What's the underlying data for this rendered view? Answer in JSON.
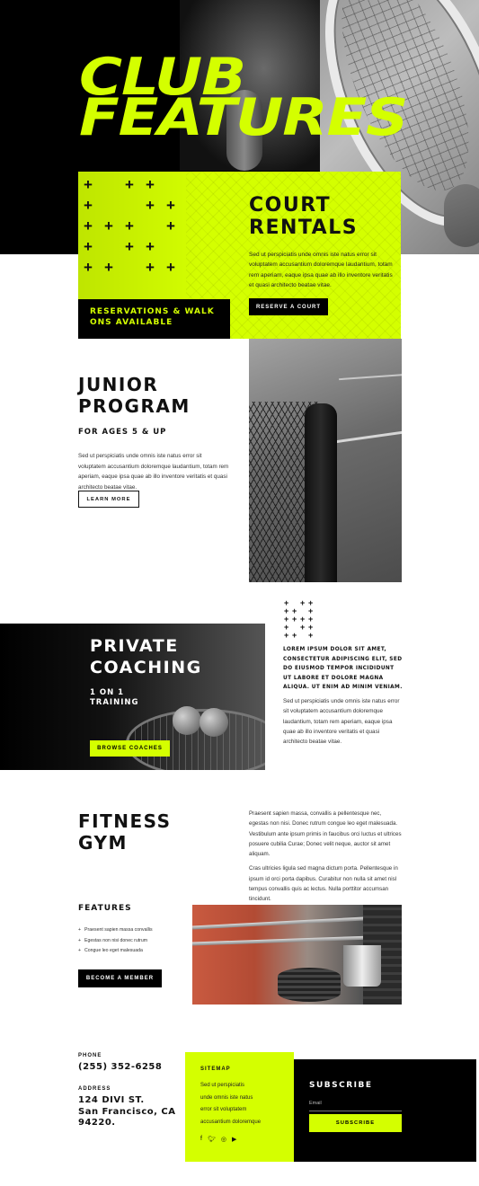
{
  "hero": {
    "title_line1": "CLUB",
    "title_line2": "FEATURES"
  },
  "court": {
    "title_line1": "COURT",
    "title_line2": "RENTALS",
    "text": "Sed ut perspiciatis unde omnis iste natus error sit voluptatem accusantium doloremque laudantium, totam rem aperiam, eaque ipsa quae ab illo inventore veritatis et quasi architecto beatae vitae.",
    "button": "RESERVE A COURT",
    "badge_line1": "RESERVATIONS & WALK",
    "badge_line2": "ONS AVAILABLE"
  },
  "junior": {
    "title_line1": "JUNIOR",
    "title_line2": "PROGRAM",
    "subtitle": "FOR AGES 5 & UP",
    "text": "Sed ut perspiciatis unde omnis iste natus error sit voluptatem accusantium doloremque laudantium, totam rem aperiam, eaque ipsa quae ab illo inventore veritatis et quasi architecto beatae vitae.",
    "button": "LEARN MORE"
  },
  "coaching": {
    "title_line1": "PRIVATE",
    "title_line2": "COACHING",
    "sub_line1": "1 ON 1",
    "sub_line2": "TRAINING",
    "button": "BROWSE COACHES",
    "bold_text": "LOREM IPSUM DOLOR SIT AMET, CONSECTETUR ADIPISCING ELIT, SED DO EIUSMOD TEMPOR INCIDIDUNT UT LABORE ET DOLORE MAGNA ALIQUA. UT ENIM AD MINIM VENIAM.",
    "text": "Sed ut perspiciatis unde omnis iste natus error sit voluptatem accusantium doloremque laudantium, totam rem aperiam, eaque ipsa quae ab illo inventore veritatis et quasi architecto beatae vitae."
  },
  "fitness": {
    "title_line1": "FITNESS",
    "title_line2": "GYM",
    "para1": "Praesent sapien massa, convallis a pellentesque nec, egestas non nisi. Donec rutrum congue leo eget malesuada. Vestibulum ante ipsum primis in faucibus orci luctus et ultrices posuere cubilia Curae; Donec velit neque, auctor sit amet aliquam.",
    "para2": "Cras ultricies ligula sed magna dictum porta. Pellentesque in ipsum id orci porta dapibus. Curabitur non nulla sit amet nisl tempus convallis quis ac lectus. Nulla porttitor accumsan tincidunt.",
    "features_title": "FEATURES",
    "features": [
      "Praesent sapien massa convallis",
      "Egestas non nisi donec rutrum",
      "Congue leo eget malesuada"
    ],
    "button": "BECOME A MEMBER"
  },
  "footer": {
    "phone_label": "PHONE",
    "phone": "(255) 352-6258",
    "address_label": "ADDRESS",
    "address_line1": "124 DIVI ST.",
    "address_line2": "San Francisco, CA",
    "address_line3": "94220.",
    "sitemap_title": "SITEMAP",
    "sitemap_links": [
      "Sed ut perspiciatis",
      "unde omnis iste natus",
      "error sit voluptatem",
      "accusantium doloremque"
    ],
    "socials": [
      "facebook-icon",
      "twitter-icon",
      "instagram-icon",
      "youtube-icon"
    ],
    "subscribe_title": "SUBSCRIBE",
    "email_placeholder": "Email",
    "subscribe_button": "SUBSCRIBE"
  },
  "colors": {
    "accent": "#d4ff00",
    "dark": "#000000"
  }
}
